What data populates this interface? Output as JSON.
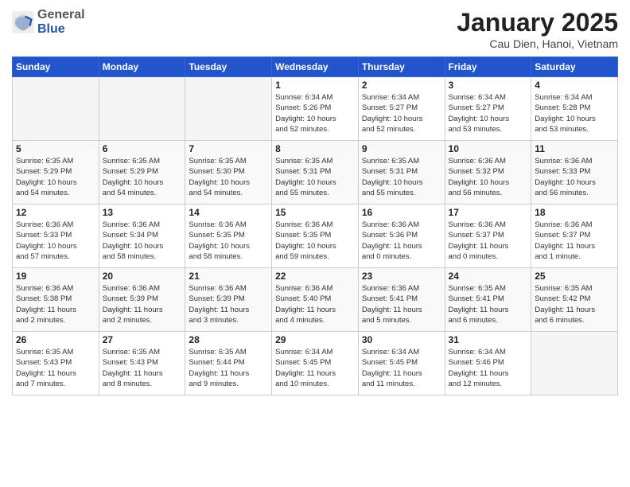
{
  "header": {
    "logo_general": "General",
    "logo_blue": "Blue",
    "month_title": "January 2025",
    "subtitle": "Cau Dien, Hanoi, Vietnam"
  },
  "days_of_week": [
    "Sunday",
    "Monday",
    "Tuesday",
    "Wednesday",
    "Thursday",
    "Friday",
    "Saturday"
  ],
  "weeks": [
    [
      {
        "day": "",
        "info": ""
      },
      {
        "day": "",
        "info": ""
      },
      {
        "day": "",
        "info": ""
      },
      {
        "day": "1",
        "info": "Sunrise: 6:34 AM\nSunset: 5:26 PM\nDaylight: 10 hours\nand 52 minutes."
      },
      {
        "day": "2",
        "info": "Sunrise: 6:34 AM\nSunset: 5:27 PM\nDaylight: 10 hours\nand 52 minutes."
      },
      {
        "day": "3",
        "info": "Sunrise: 6:34 AM\nSunset: 5:27 PM\nDaylight: 10 hours\nand 53 minutes."
      },
      {
        "day": "4",
        "info": "Sunrise: 6:34 AM\nSunset: 5:28 PM\nDaylight: 10 hours\nand 53 minutes."
      }
    ],
    [
      {
        "day": "5",
        "info": "Sunrise: 6:35 AM\nSunset: 5:29 PM\nDaylight: 10 hours\nand 54 minutes."
      },
      {
        "day": "6",
        "info": "Sunrise: 6:35 AM\nSunset: 5:29 PM\nDaylight: 10 hours\nand 54 minutes."
      },
      {
        "day": "7",
        "info": "Sunrise: 6:35 AM\nSunset: 5:30 PM\nDaylight: 10 hours\nand 54 minutes."
      },
      {
        "day": "8",
        "info": "Sunrise: 6:35 AM\nSunset: 5:31 PM\nDaylight: 10 hours\nand 55 minutes."
      },
      {
        "day": "9",
        "info": "Sunrise: 6:35 AM\nSunset: 5:31 PM\nDaylight: 10 hours\nand 55 minutes."
      },
      {
        "day": "10",
        "info": "Sunrise: 6:36 AM\nSunset: 5:32 PM\nDaylight: 10 hours\nand 56 minutes."
      },
      {
        "day": "11",
        "info": "Sunrise: 6:36 AM\nSunset: 5:33 PM\nDaylight: 10 hours\nand 56 minutes."
      }
    ],
    [
      {
        "day": "12",
        "info": "Sunrise: 6:36 AM\nSunset: 5:33 PM\nDaylight: 10 hours\nand 57 minutes."
      },
      {
        "day": "13",
        "info": "Sunrise: 6:36 AM\nSunset: 5:34 PM\nDaylight: 10 hours\nand 58 minutes."
      },
      {
        "day": "14",
        "info": "Sunrise: 6:36 AM\nSunset: 5:35 PM\nDaylight: 10 hours\nand 58 minutes."
      },
      {
        "day": "15",
        "info": "Sunrise: 6:36 AM\nSunset: 5:35 PM\nDaylight: 10 hours\nand 59 minutes."
      },
      {
        "day": "16",
        "info": "Sunrise: 6:36 AM\nSunset: 5:36 PM\nDaylight: 11 hours\nand 0 minutes."
      },
      {
        "day": "17",
        "info": "Sunrise: 6:36 AM\nSunset: 5:37 PM\nDaylight: 11 hours\nand 0 minutes."
      },
      {
        "day": "18",
        "info": "Sunrise: 6:36 AM\nSunset: 5:37 PM\nDaylight: 11 hours\nand 1 minute."
      }
    ],
    [
      {
        "day": "19",
        "info": "Sunrise: 6:36 AM\nSunset: 5:38 PM\nDaylight: 11 hours\nand 2 minutes."
      },
      {
        "day": "20",
        "info": "Sunrise: 6:36 AM\nSunset: 5:39 PM\nDaylight: 11 hours\nand 2 minutes."
      },
      {
        "day": "21",
        "info": "Sunrise: 6:36 AM\nSunset: 5:39 PM\nDaylight: 11 hours\nand 3 minutes."
      },
      {
        "day": "22",
        "info": "Sunrise: 6:36 AM\nSunset: 5:40 PM\nDaylight: 11 hours\nand 4 minutes."
      },
      {
        "day": "23",
        "info": "Sunrise: 6:36 AM\nSunset: 5:41 PM\nDaylight: 11 hours\nand 5 minutes."
      },
      {
        "day": "24",
        "info": "Sunrise: 6:35 AM\nSunset: 5:41 PM\nDaylight: 11 hours\nand 6 minutes."
      },
      {
        "day": "25",
        "info": "Sunrise: 6:35 AM\nSunset: 5:42 PM\nDaylight: 11 hours\nand 6 minutes."
      }
    ],
    [
      {
        "day": "26",
        "info": "Sunrise: 6:35 AM\nSunset: 5:43 PM\nDaylight: 11 hours\nand 7 minutes."
      },
      {
        "day": "27",
        "info": "Sunrise: 6:35 AM\nSunset: 5:43 PM\nDaylight: 11 hours\nand 8 minutes."
      },
      {
        "day": "28",
        "info": "Sunrise: 6:35 AM\nSunset: 5:44 PM\nDaylight: 11 hours\nand 9 minutes."
      },
      {
        "day": "29",
        "info": "Sunrise: 6:34 AM\nSunset: 5:45 PM\nDaylight: 11 hours\nand 10 minutes."
      },
      {
        "day": "30",
        "info": "Sunrise: 6:34 AM\nSunset: 5:45 PM\nDaylight: 11 hours\nand 11 minutes."
      },
      {
        "day": "31",
        "info": "Sunrise: 6:34 AM\nSunset: 5:46 PM\nDaylight: 11 hours\nand 12 minutes."
      },
      {
        "day": "",
        "info": ""
      }
    ]
  ]
}
